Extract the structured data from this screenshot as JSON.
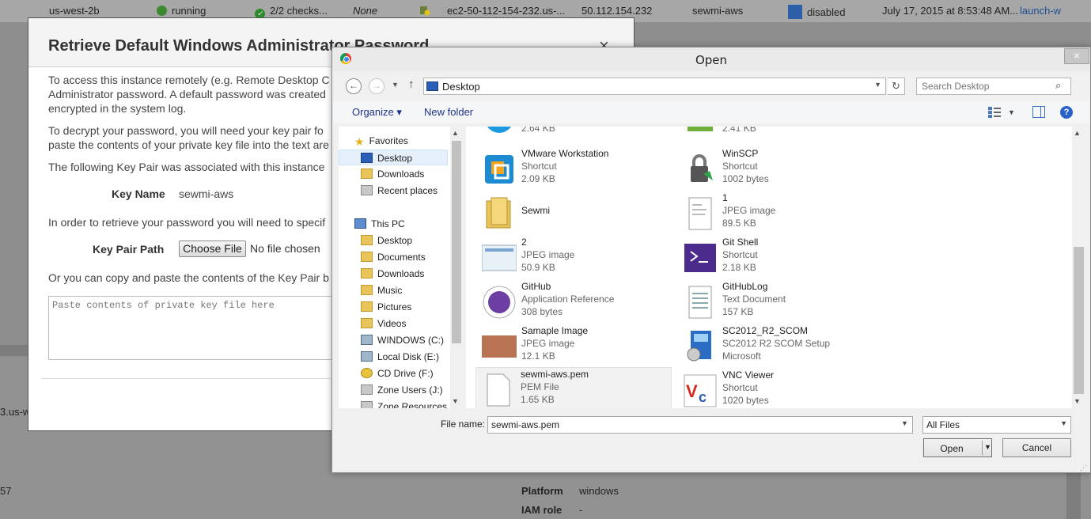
{
  "background": {
    "row": {
      "zone": "us-west-2b",
      "state": "running",
      "checks": "2/2 checks...",
      "alarm": "None",
      "dns": "ec2-50-112-154-232.us-...",
      "ip": "50.112.154.232",
      "key": "sewmi-aws",
      "monitoring": "disabled",
      "launch_time": "July 17, 2015 at 8:53:48 AM...",
      "launch_link": "launch-w"
    },
    "left_fragment_1": "3.us-w",
    "left_fragment_2": "57",
    "details": [
      {
        "label": "Platform",
        "value": "windows"
      },
      {
        "label": "IAM role",
        "value": "-"
      }
    ]
  },
  "modal": {
    "title": "Retrieve Default Windows Administrator Password",
    "close": "×",
    "para1_line1": "To access this instance remotely (e.g. Remote Desktop C",
    "para1_line2": "Administrator password. A default password was created",
    "para1_line3": "encrypted in the system log.",
    "para2_line1": "To decrypt your password, you will need your key pair fo",
    "para2_line2": "paste the contents of your private key file into the text are",
    "para3": "The following Key Pair was associated with this instance",
    "key_name_label": "Key Name",
    "key_name_value": "sewmi-aws",
    "para4": "In order to retrieve your password you will need to specif",
    "key_pair_path_label": "Key Pair Path",
    "choose_file": "Choose File",
    "no_file": "No file chosen",
    "para5": "Or you can copy and paste the contents of the Key Pair b",
    "textarea_placeholder": "Paste contents of private key file here"
  },
  "dialog": {
    "title": "Open",
    "close": "×",
    "address": "Desktop",
    "search_placeholder": "Search Desktop",
    "organize": "Organize ▾",
    "new_folder": "New folder",
    "nav": [
      {
        "label": "Favorites",
        "icon": "star-icon"
      },
      {
        "label": "Desktop",
        "icon": "desktop-icon"
      },
      {
        "label": "Downloads",
        "icon": "folder-icon"
      },
      {
        "label": "Recent places",
        "icon": "recent-icon"
      },
      {
        "label": "This PC",
        "icon": "pc-icon"
      },
      {
        "label": "Desktop",
        "icon": "desktop-icon"
      },
      {
        "label": "Documents",
        "icon": "folder-icon"
      },
      {
        "label": "Downloads",
        "icon": "folder-icon"
      },
      {
        "label": "Music",
        "icon": "folder-icon"
      },
      {
        "label": "Pictures",
        "icon": "folder-icon"
      },
      {
        "label": "Videos",
        "icon": "folder-icon"
      },
      {
        "label": "WINDOWS (C:)",
        "icon": "drive-icon"
      },
      {
        "label": "Local Disk (E:)",
        "icon": "drive-icon"
      },
      {
        "label": "CD Drive (F:)",
        "icon": "cd-icon"
      },
      {
        "label": "Zone Users (J:)",
        "icon": "network-drive-icon"
      },
      {
        "label": "Zone Resources (",
        "icon": "network-drive-icon"
      }
    ],
    "files": [
      {
        "name": "",
        "type": "",
        "size": "2.64 KB",
        "icon": "skype-icon"
      },
      {
        "name": "",
        "type": "",
        "size": "2.41 KB",
        "icon": "app-icon"
      },
      {
        "name": "VMware Workstation",
        "type": "Shortcut",
        "size": "2.09 KB",
        "icon": "vmware-icon"
      },
      {
        "name": "WinSCP",
        "type": "Shortcut",
        "size": "1002 bytes",
        "icon": "winscp-icon"
      },
      {
        "name": "Sewmi",
        "type": "",
        "size": "",
        "icon": "folder-icon"
      },
      {
        "name": "1",
        "type": "JPEG image",
        "size": "89.5 KB",
        "icon": "document-icon"
      },
      {
        "name": "2",
        "type": "JPEG image",
        "size": "50.9 KB",
        "icon": "image-thumbnail-icon"
      },
      {
        "name": "Git Shell",
        "type": "Shortcut",
        "size": "2.18 KB",
        "icon": "git-shell-icon"
      },
      {
        "name": "GitHub",
        "type": "Application Reference",
        "size": "308 bytes",
        "icon": "github-icon"
      },
      {
        "name": "GitHubLog",
        "type": "Text Document",
        "size": "157 KB",
        "icon": "text-document-icon"
      },
      {
        "name": "Samaple Image",
        "type": "JPEG image",
        "size": "12.1 KB",
        "icon": "image-thumbnail-icon"
      },
      {
        "name": "SC2012_R2_SCOM",
        "type": "SC2012 R2 SCOM Setup",
        "size": "Microsoft",
        "icon": "installer-icon"
      },
      {
        "name": "sewmi-aws.pem",
        "type": "PEM File",
        "size": "1.65 KB",
        "icon": "blank-file-icon"
      },
      {
        "name": "VNC Viewer",
        "type": "Shortcut",
        "size": "1020 bytes",
        "icon": "vnc-icon"
      }
    ],
    "file_name_label": "File name:",
    "file_name_value": "sewmi-aws.pem",
    "file_type": "All Files",
    "open_label": "Open",
    "cancel_label": "Cancel"
  },
  "colors": {
    "aws_overlay": "#8e8e8e",
    "win_select": "#e5f0fb",
    "link_blue": "#1e3287"
  }
}
